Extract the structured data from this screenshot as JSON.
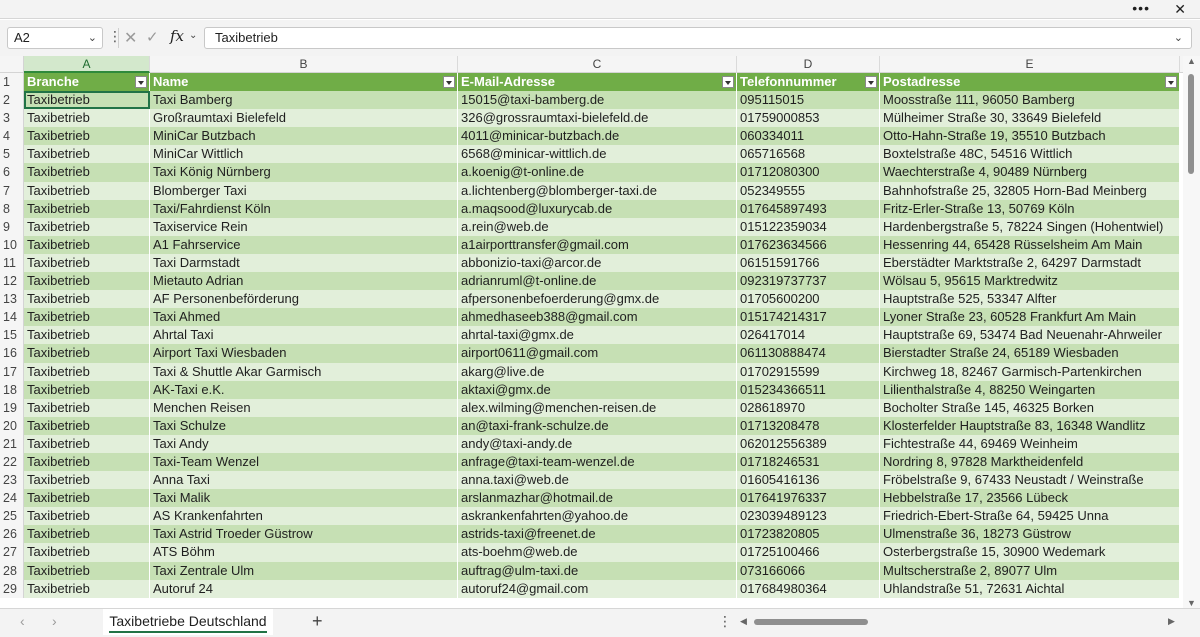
{
  "window": {
    "more_label": "•••",
    "close_label": "✕"
  },
  "formula_bar": {
    "name_box": "A2",
    "formula": "Taxibetrieb"
  },
  "sheet": {
    "columns": [
      "A",
      "B",
      "C",
      "D",
      "E"
    ],
    "header": [
      "Branche",
      "Name",
      "E-Mail-Adresse",
      "Telefonnummer",
      "Postadresse"
    ],
    "rows": [
      {
        "n": "2",
        "cells": [
          "Taxibetrieb",
          "Taxi Bamberg",
          "15015@taxi-bamberg.de",
          "095115015",
          "Moosstraße 111, 96050 Bamberg"
        ]
      },
      {
        "n": "3",
        "cells": [
          "Taxibetrieb",
          "Großraumtaxi Bielefeld",
          "326@grossraumtaxi-bielefeld.de",
          "01759000853",
          "Mülheimer Straße 30, 33649 Bielefeld"
        ]
      },
      {
        "n": "4",
        "cells": [
          "Taxibetrieb",
          "MiniCar Butzbach",
          "4011@minicar-butzbach.de",
          "060334011",
          "Otto-Hahn-Straße 19, 35510 Butzbach"
        ]
      },
      {
        "n": "5",
        "cells": [
          "Taxibetrieb",
          "MiniCar Wittlich",
          "6568@minicar-wittlich.de",
          "065716568",
          "Boxtelstraße 48C, 54516 Wittlich"
        ]
      },
      {
        "n": "6",
        "cells": [
          "Taxibetrieb",
          "Taxi König Nürnberg",
          "a.koenig@t-online.de",
          "01712080300",
          "Waechterstraße 4, 90489 Nürnberg"
        ]
      },
      {
        "n": "7",
        "cells": [
          "Taxibetrieb",
          "Blomberger Taxi",
          "a.lichtenberg@blomberger-taxi.de",
          "052349555",
          "Bahnhofstraße 25, 32805 Horn-Bad Meinberg"
        ]
      },
      {
        "n": "8",
        "cells": [
          "Taxibetrieb",
          "Taxi/Fahrdienst Köln",
          "a.maqsood@luxurycab.de",
          "017645897493",
          "Fritz-Erler-Straße 13, 50769 Köln"
        ]
      },
      {
        "n": "9",
        "cells": [
          "Taxibetrieb",
          "Taxiservice Rein",
          "a.rein@web.de",
          "015122359034",
          "Hardenbergstraße 5, 78224 Singen (Hohentwiel)"
        ]
      },
      {
        "n": "10",
        "cells": [
          "Taxibetrieb",
          "A1 Fahrservice",
          "a1airporttransfer@gmail.com",
          "017623634566",
          "Hessenring 44, 65428 Rüsselsheim Am Main"
        ]
      },
      {
        "n": "11",
        "cells": [
          "Taxibetrieb",
          "Taxi Darmstadt",
          "abbonizio-taxi@arcor.de",
          "06151591766",
          "Eberstädter Marktstraße 2, 64297 Darmstadt"
        ]
      },
      {
        "n": "12",
        "cells": [
          "Taxibetrieb",
          "Mietauto Adrian",
          "adrianruml@t-online.de",
          "092319737737",
          "Wölsau 5, 95615 Marktredwitz"
        ]
      },
      {
        "n": "13",
        "cells": [
          "Taxibetrieb",
          "AF Personenbeförderung",
          "afpersonenbefoerderung@gmx.de",
          "01705600200",
          "Hauptstraße 525, 53347 Alfter"
        ]
      },
      {
        "n": "14",
        "cells": [
          "Taxibetrieb",
          "Taxi Ahmed",
          "ahmedhaseeb388@gmail.com",
          "015174214317",
          "Lyoner Straße 23, 60528 Frankfurt Am Main"
        ]
      },
      {
        "n": "15",
        "cells": [
          "Taxibetrieb",
          "Ahrtal Taxi",
          "ahrtal-taxi@gmx.de",
          "026417014",
          "Hauptstraße 69, 53474 Bad Neuenahr-Ahrweiler"
        ]
      },
      {
        "n": "16",
        "cells": [
          "Taxibetrieb",
          "Airport Taxi Wiesbaden",
          "airport0611@gmail.com",
          "061130888474",
          "Bierstadter Straße 24, 65189 Wiesbaden"
        ]
      },
      {
        "n": "17",
        "cells": [
          "Taxibetrieb",
          "Taxi & Shuttle Akar Garmisch",
          "akarg@live.de",
          "01702915599",
          "Kirchweg 18, 82467 Garmisch-Partenkirchen"
        ]
      },
      {
        "n": "18",
        "cells": [
          "Taxibetrieb",
          "AK-Taxi e.K.",
          "aktaxi@gmx.de",
          "015234366511",
          "Lilienthalstraße 4, 88250 Weingarten"
        ]
      },
      {
        "n": "19",
        "cells": [
          "Taxibetrieb",
          "Menchen Reisen",
          "alex.wilming@menchen-reisen.de",
          "028618970",
          "Bocholter Straße 145, 46325 Borken"
        ]
      },
      {
        "n": "20",
        "cells": [
          "Taxibetrieb",
          "Taxi Schulze",
          "an@taxi-frank-schulze.de",
          "01713208478",
          "Klosterfelder Hauptstraße 83, 16348 Wandlitz"
        ]
      },
      {
        "n": "21",
        "cells": [
          "Taxibetrieb",
          "Taxi Andy",
          "andy@taxi-andy.de",
          "062012556389",
          "Fichtestraße 44, 69469 Weinheim"
        ]
      },
      {
        "n": "22",
        "cells": [
          "Taxibetrieb",
          "Taxi-Team Wenzel",
          "anfrage@taxi-team-wenzel.de",
          "01718246531",
          "Nordring 8, 97828 Marktheidenfeld"
        ]
      },
      {
        "n": "23",
        "cells": [
          "Taxibetrieb",
          "Anna Taxi",
          "anna.taxi@web.de",
          "01605416136",
          "Fröbelstraße 9, 67433 Neustadt / Weinstraße"
        ]
      },
      {
        "n": "24",
        "cells": [
          "Taxibetrieb",
          "Taxi Malik",
          "arslanmazhar@hotmail.de",
          "017641976337",
          "Hebbelstraße 17, 23566 Lübeck"
        ]
      },
      {
        "n": "25",
        "cells": [
          "Taxibetrieb",
          "AS Krankenfahrten",
          "askrankenfahrten@yahoo.de",
          "023039489123",
          "Friedrich-Ebert-Straße 64, 59425 Unna"
        ]
      },
      {
        "n": "26",
        "cells": [
          "Taxibetrieb",
          "Taxi Astrid Troeder Güstrow",
          "astrids-taxi@freenet.de",
          "01723820805",
          "Ulmenstraße 36, 18273 Güstrow"
        ]
      },
      {
        "n": "27",
        "cells": [
          "Taxibetrieb",
          "ATS Böhm",
          "ats-boehm@web.de",
          "01725100466",
          "Osterbergstraße 15, 30900 Wedemark"
        ]
      },
      {
        "n": "28",
        "cells": [
          "Taxibetrieb",
          "Taxi Zentrale Ulm",
          "auftrag@ulm-taxi.de",
          "073166066",
          "Multscherstraße 2, 89077 Ulm"
        ]
      },
      {
        "n": "29",
        "cells": [
          "Taxibetrieb",
          "Autoruf 24",
          "autoruf24@gmail.com",
          "017684980364",
          "Uhlandstraße 51, 72631 Aichtal"
        ]
      }
    ]
  },
  "tabs": {
    "active": "Taxibetriebe Deutschland",
    "add_label": "+"
  }
}
